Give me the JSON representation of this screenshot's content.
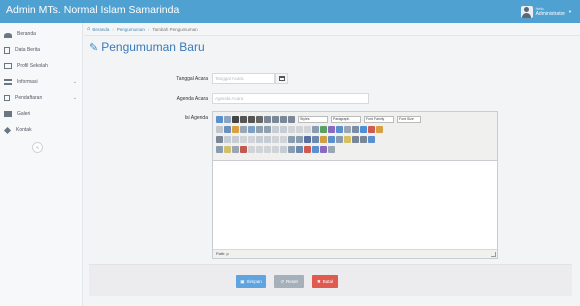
{
  "header": {
    "app_title": "Admin MTs. Normal Islam Samarinda",
    "user_greeting": "Hello,",
    "user_name": "Administrator"
  },
  "sidebar": {
    "items": [
      {
        "label": "Beranda",
        "icon": "dashboard-icon"
      },
      {
        "label": "Data Berita",
        "icon": "document-icon"
      },
      {
        "label": "Profil Sekolah",
        "icon": "monitor-icon"
      },
      {
        "label": "Informasi",
        "icon": "list-icon"
      },
      {
        "label": "Pendaftaran",
        "icon": "edit-icon"
      },
      {
        "label": "Galeri",
        "icon": "picture-icon"
      },
      {
        "label": "Kontak",
        "icon": "tag-icon"
      }
    ]
  },
  "breadcrumb": {
    "home": "Beranda",
    "section": "Pengumuman",
    "current": "Tambah Pengumuman"
  },
  "page": {
    "title": "Pengumuman Baru"
  },
  "form": {
    "tanggal_label": "Tanggal Acara",
    "tanggal_placeholder": "Tanggal Acara",
    "agenda_label": "Agenda Acara",
    "agenda_placeholder": "Agenda Acara",
    "isi_label": "Isi Agenda",
    "editor": {
      "styles": "Styles",
      "paragraph": "Paragraph",
      "font_family": "Font Family",
      "font_size": "Font Size",
      "path": "Path: p"
    }
  },
  "buttons": {
    "save": "Simpan",
    "reset": "Reset",
    "cancel": "Batal"
  },
  "colors": {
    "header": "#4fa1d2",
    "title": "#3a7ab8",
    "save": "#5fa4e0",
    "reset": "#a6b0ba",
    "cancel": "#e05a4f"
  }
}
